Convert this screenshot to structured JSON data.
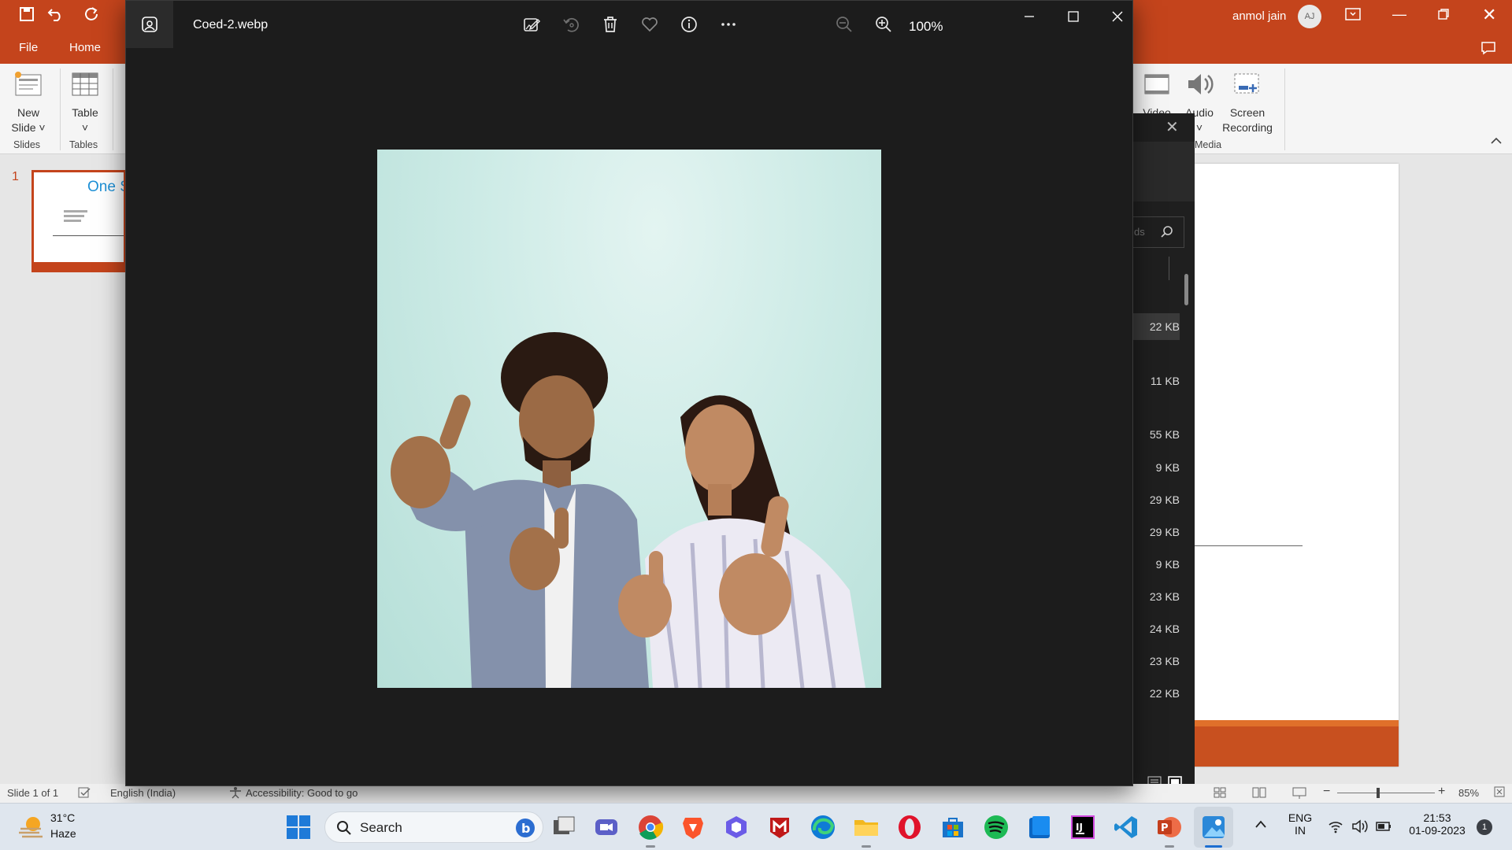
{
  "powerpoint": {
    "user_name": "anmol jain",
    "user_initials": "AJ",
    "tabs": [
      "File",
      "Home"
    ],
    "ribbon": {
      "new_slide_label": "New",
      "new_slide_label2": "Slide",
      "table_label": "Table",
      "video_label": "Video",
      "audio_label": "Audio",
      "screen_recording_label": "Screen",
      "screen_recording_label2": "Recording",
      "groups": {
        "slides": "Slides",
        "tables": "Tables",
        "media": "Media"
      }
    },
    "thumbnail": {
      "number": "1",
      "title": "One Sp"
    },
    "file_sizes": [
      "22 KB",
      "11 KB",
      "55 KB",
      "9 KB",
      "29 KB",
      "29 KB",
      "9 KB",
      "23 KB",
      "24 KB",
      "23 KB",
      "22 KB"
    ],
    "panel_search_placeholder": "ds",
    "status": {
      "slide": "Slide 1 of 1",
      "language": "English (India)",
      "accessibility": "Accessibility: Good to go",
      "zoom": "85%"
    }
  },
  "photos_app": {
    "file_name": "Coed-2.webp",
    "zoom": "100%",
    "toolbar_icons": [
      "edit-image-icon",
      "rotate-icon",
      "delete-icon",
      "favorite-icon",
      "info-icon",
      "more-icon"
    ]
  },
  "taskbar": {
    "weather": {
      "temp": "31°C",
      "desc": "Haze"
    },
    "search_label": "Search",
    "language": {
      "line1": "ENG",
      "line2": "IN"
    },
    "clock": {
      "time": "21:53",
      "date": "01-09-2023"
    },
    "notification_count": "1"
  },
  "colors": {
    "ppt_accent": "#c4441c",
    "photos_bg": "#1c1c1c",
    "taskbar_bg": "#dfe6ee"
  }
}
